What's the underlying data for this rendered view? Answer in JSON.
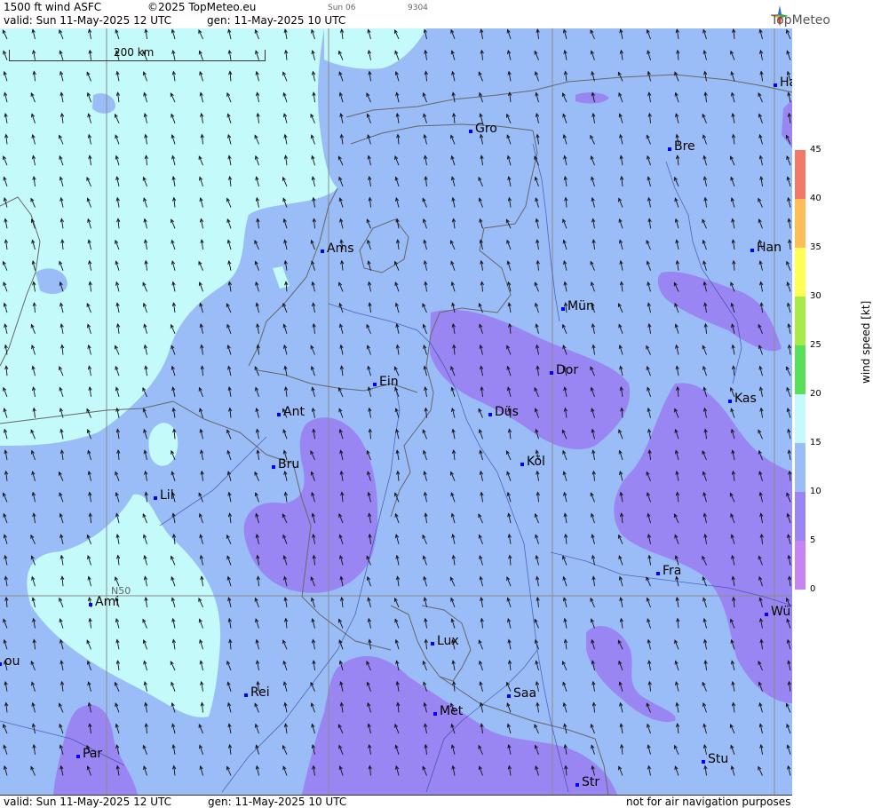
{
  "header": {
    "line1_product": "1500 ft wind ASFC",
    "line1_copyright": "©2025 TopMeteo.eu",
    "line1_day": "Sun 06",
    "line1_code": "9304",
    "line2_valid": "valid:  Sun  11-May-2025  12 UTC",
    "line2_gen": "gen: 11-May-2025 10 UTC",
    "logo_text": "TopMeteo"
  },
  "footer": {
    "valid": "valid:  Sun  11-May-2025  12 UTC",
    "gen": "gen: 11-May-2025 10 UTC",
    "disclaimer": "not for air navigation purposes"
  },
  "map": {
    "scale_label": "200 km",
    "lat_label": "N50",
    "cities": [
      {
        "name": "Ha"
      },
      {
        "name": "Gro"
      },
      {
        "name": "Bre"
      },
      {
        "name": "Ams"
      },
      {
        "name": "Han"
      },
      {
        "name": "Mün"
      },
      {
        "name": "Ein"
      },
      {
        "name": "Dor"
      },
      {
        "name": "Kas"
      },
      {
        "name": "Ant"
      },
      {
        "name": "Düs"
      },
      {
        "name": "Bru"
      },
      {
        "name": "Köl"
      },
      {
        "name": "Lil"
      },
      {
        "name": "Fra"
      },
      {
        "name": "Ami"
      },
      {
        "name": "Wü"
      },
      {
        "name": "ou"
      },
      {
        "name": "Lux"
      },
      {
        "name": "Rei"
      },
      {
        "name": "Saa"
      },
      {
        "name": "Met"
      },
      {
        "name": "Par"
      },
      {
        "name": "Stu"
      },
      {
        "name": "Str"
      }
    ]
  },
  "colorbar": {
    "title": "wind  speed  [kt]",
    "ticks": [
      "45",
      "40",
      "35",
      "30",
      "25",
      "20",
      "15",
      "10",
      "5",
      "0"
    ],
    "colors": {
      "band_0_5": "#c584f2",
      "band_5_10": "#9a86f3",
      "band_10_15": "#9bbdf7",
      "band_15_20": "#c4fafa",
      "band_20_25": "#58e05a",
      "band_25_30": "#a8ea48",
      "band_30_35": "#fffe52",
      "band_35_40": "#ffbe55",
      "band_40_45": "#f27868"
    }
  }
}
